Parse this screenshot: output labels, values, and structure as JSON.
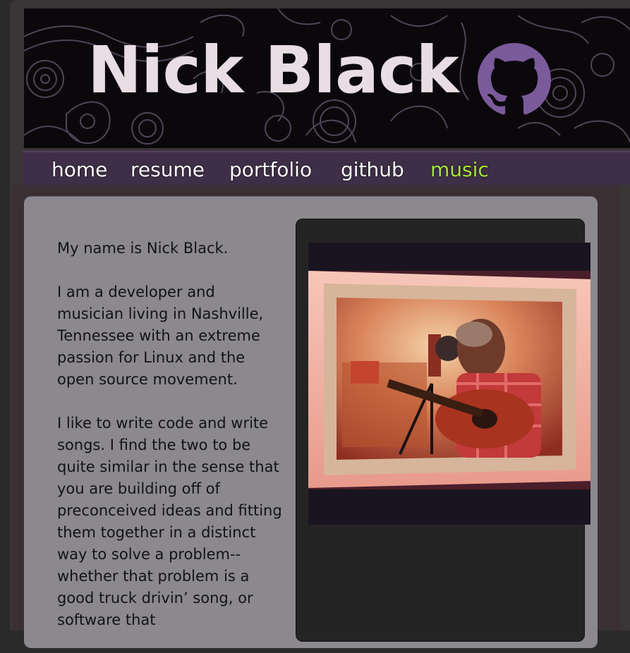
{
  "header": {
    "title": "Nick Black",
    "logo_icon": "github-octocat-icon",
    "background_pattern": "paisley",
    "accent_color": "#7b5a9b",
    "title_color": "#e8dde2"
  },
  "nav": {
    "items": [
      {
        "label": "home",
        "active": false
      },
      {
        "label": "resume",
        "active": false
      },
      {
        "label": "portfolio",
        "active": false
      },
      {
        "label": "github",
        "active": false
      },
      {
        "label": "music",
        "active": true
      }
    ],
    "active_color": "#a6e83a",
    "bar_color": "#3f2e47"
  },
  "bio": {
    "paragraphs": [
      "My name is Nick Black.",
      "I am a developer and musician living in Nashville, Tennessee with an extreme passion for Linux and the open source movement.",
      "I like to write code and write songs. I find the two to be quite similar in the sense that you are building off of preconceived ideas and fitting them together in a distinct way to solve a problem--whether that problem is a good truck drivin’ song, or software that"
    ]
  },
  "photo": {
    "subject": "musician-in-recording-booth-photo"
  }
}
